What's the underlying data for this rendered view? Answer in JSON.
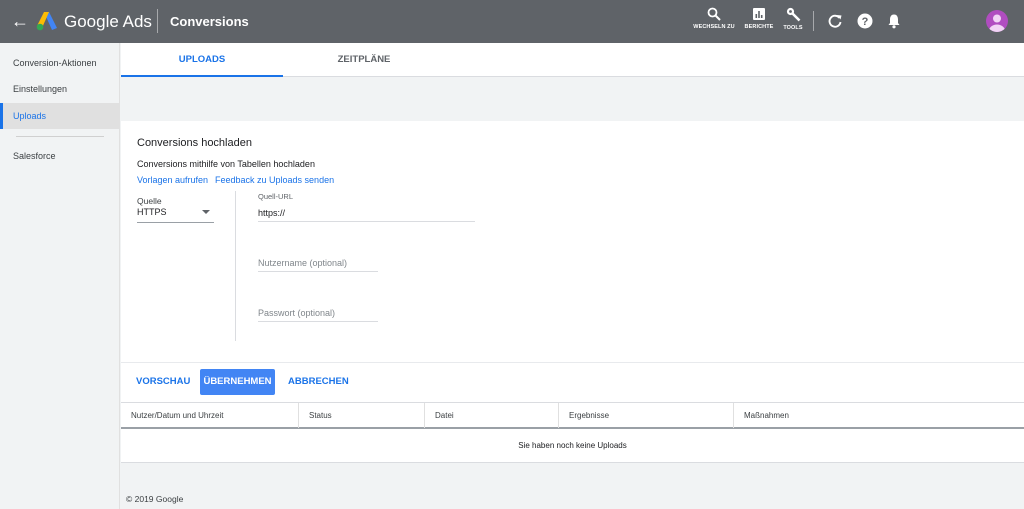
{
  "header": {
    "brand": "Google Ads",
    "page_title": "Conversions",
    "tools": [
      {
        "icon": "search-icon",
        "label": "WECHSELN ZU"
      },
      {
        "icon": "reports-icon",
        "label": "BERICHTE"
      },
      {
        "icon": "wrench-icon",
        "label": "TOOLS"
      }
    ]
  },
  "sidebar": {
    "items": [
      {
        "label": "Conversion-Aktionen"
      },
      {
        "label": "Einstellungen"
      },
      {
        "label": "Uploads",
        "active": true
      },
      {
        "label": "Salesforce"
      }
    ]
  },
  "tabs": [
    {
      "label": "UPLOADS",
      "active": true
    },
    {
      "label": "ZEITPLÄNE"
    }
  ],
  "upload": {
    "title": "Conversions hochladen",
    "subtitle": "Conversions mithilfe von Tabellen hochladen",
    "link_templates": "Vorlagen aufrufen",
    "link_feedback": "Feedback zu Uploads senden",
    "source_label": "Quelle",
    "source_value": "HTTPS",
    "url_label": "Quell-URL",
    "url_value": "https://",
    "username_placeholder": "Nutzername (optional)",
    "password_placeholder": "Passwort (optional)"
  },
  "actions": {
    "preview": "VORSCHAU",
    "apply": "ÜBERNEHMEN",
    "cancel": "ABBRECHEN"
  },
  "table": {
    "columns": [
      "Nutzer/Datum und Uhrzeit",
      "Status",
      "Datei",
      "Ergebnisse",
      "Maßnahmen"
    ],
    "empty_text": "Sie haben noch keine Uploads"
  },
  "footer": {
    "copyright": "© 2019 Google"
  },
  "colors": {
    "topbar": "#5f6368",
    "accent": "#1a73e8",
    "button": "#4285f4",
    "avatar": "#b04dc0"
  }
}
